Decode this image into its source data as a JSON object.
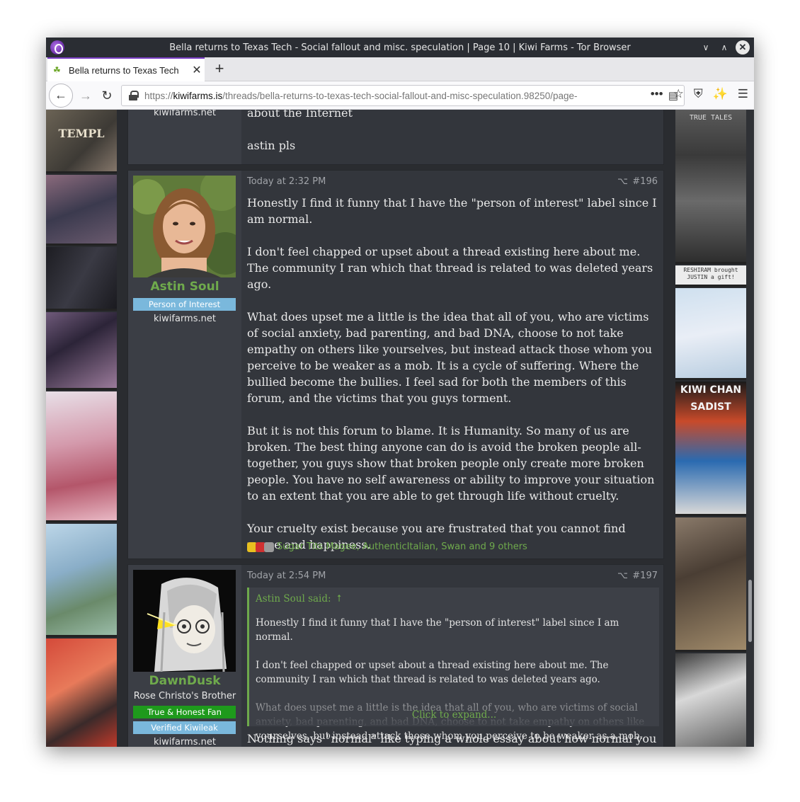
{
  "window": {
    "title": "Bella returns to Texas Tech - Social fallout and misc. speculation | Page 10 | Kiwi Farms - Tor Browser"
  },
  "tab": {
    "label": "Bella returns to Texas Tech",
    "new_tab_symbol": "+"
  },
  "urlbar": {
    "scheme": "https://",
    "domain": "kiwifarms.is",
    "path": "/threads/bella-returns-to-texas-tech-social-fallout-and-misc-speculation.98250/page-"
  },
  "background_panels": {
    "left_texts": [
      "TEMPL"
    ],
    "right_texts": [
      "TRUE",
      "TALES",
      "RESHIRAM brought JUSTIN a gift!",
      "KIWI CHAN",
      "SADIST"
    ]
  },
  "posts": [
    {
      "partial": true,
      "user_domain": "kiwifarms.net",
      "paragraphs": [
        "about the Internet",
        "astin pls"
      ]
    },
    {
      "time": "Today at 2:32 PM",
      "number": "#196",
      "username": "Astin Soul",
      "banners": [
        "Person of Interest"
      ],
      "user_domain": "kiwifarms.net",
      "paragraphs": [
        "Honestly I find it funny that I have the \"person of interest\" label since I am normal.",
        "I don't feel chapped or upset about a thread existing here about me. The community I ran which that thread is related to was deleted years ago.",
        "What does upset me a little is the idea that all of you, who are victims of social anxiety, bad parenting, and bad DNA, choose to not take empathy on others like yourselves, but instead attack those whom you perceive to be weaker as a mob. It is a cycle of suffering. Where the bullied become the bullies. I feel sad for both the members of this forum, and the victims that you guys torment.",
        "But it is not this forum to blame. It is Humanity. So many of us are broken. The best thing anyone can do is avoid the broken people all-together, you guys show that broken people only create more broken people. You have no self awareness or ability to improve your situation to an extent that you are able to get through life without cruelty.",
        "Your cruelty exist because you are frustrated that you cannot find peace and happiness."
      ],
      "reactions": "Sugar Tits Magee, AuthenticItalian, Swan and 9 others"
    },
    {
      "time": "Today at 2:54 PM",
      "number": "#197",
      "username": "DawnDusk",
      "user_title": "Rose Christo's Brother",
      "banners": [
        "True & Honest Fan",
        "Verified Kiwileak"
      ],
      "user_domain": "kiwifarms.net",
      "quote": {
        "author": "Astin Soul said:",
        "paragraphs": [
          "Honestly I find it funny that I have the \"person of interest\" label since I am normal.",
          "I don't feel chapped or upset about a thread existing here about me. The community I ran which that thread is related to was deleted years ago.",
          "What does upset me a little is the idea that all of you, who are victims of social anxiety, bad parenting, and bad DNA, choose to not take empathy on others like yourselves, but instead attack those whom you perceive to be weaker as a mob."
        ],
        "expand": "Click to expand..."
      },
      "paragraphs": [
        "Nothing says \"normal\" like typing a whole essay about how normal you are"
      ]
    }
  ],
  "colors": {
    "accent_green": "#6faa4c",
    "banner_blue": "#7ab8dc",
    "banner_green": "#1e9a1c",
    "post_bg": "#33363c",
    "userpane_bg": "#3b3e45",
    "tor_purple": "#7b3fc6"
  },
  "icons": {
    "tor": "tor-onion-icon",
    "share": "share-icon",
    "quote_jump": "arrow-up-circle-icon"
  }
}
